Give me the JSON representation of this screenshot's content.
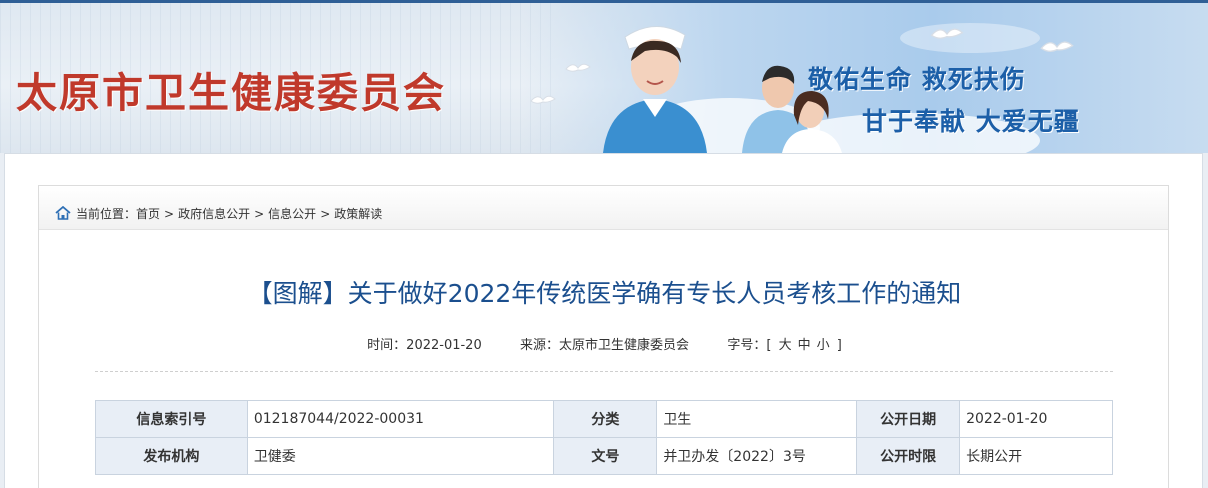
{
  "header": {
    "site_title": "太原市卫生健康委员会",
    "slogan_line1": "敬佑生命 救死扶伤",
    "slogan_line2": "甘于奉献 大爱无疆"
  },
  "breadcrumb": {
    "prefix": "当前位置：",
    "items": [
      "首页",
      "政府信息公开",
      "信息公开",
      "政策解读"
    ],
    "separator": ">"
  },
  "article": {
    "title": "【图解】关于做好2022年传统医学确有专长人员考核工作的通知",
    "time_label": "时间：",
    "time_value": "2022-01-20",
    "source_label": "来源：",
    "source_value": "太原市卫生健康委员会",
    "fontsize_label": "字号：",
    "fontsize_open": "[",
    "fontsize_large": "大",
    "fontsize_medium": "中",
    "fontsize_small": "小",
    "fontsize_close": "]"
  },
  "info_table": {
    "row1": {
      "k1": "信息索引号",
      "v1": "012187044/2022-00031",
      "k2": "分类",
      "v2": "卫生",
      "k3": "公开日期",
      "v3": "2022-01-20"
    },
    "row2": {
      "k1": "发布机构",
      "v1": "卫健委",
      "k2": "文号",
      "v2": "并卫办发〔2022〕3号",
      "k3": "公开时限",
      "v3": "长期公开"
    }
  },
  "colors": {
    "title_red": "#c0392b",
    "slogan_blue": "#1c5fa8",
    "article_title_blue": "#1b4f8e",
    "table_key_bg": "#e8eef6"
  }
}
